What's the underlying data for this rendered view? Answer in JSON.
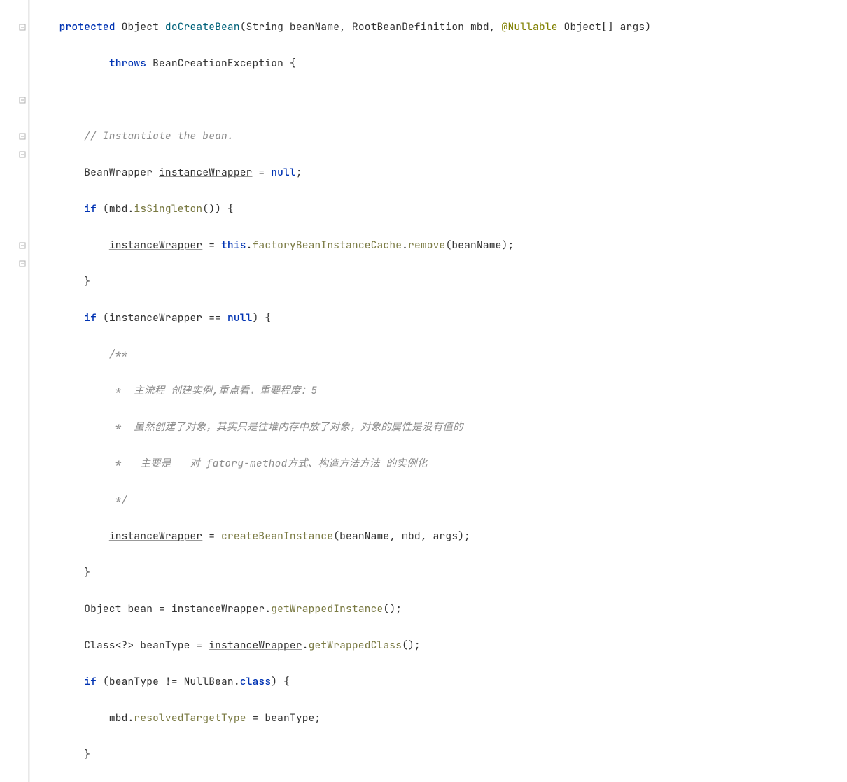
{
  "gutter": {
    "markers": [
      false,
      true,
      false,
      false,
      false,
      true,
      false,
      true,
      true,
      false,
      false,
      false,
      false,
      true,
      true,
      false,
      false,
      false,
      false,
      false,
      false
    ]
  },
  "code": {
    "l0": {
      "kw1": "protected",
      "t1": " Object ",
      "m": "doCreateBean",
      "t2": "(String beanName, RootBeanDefinition mbd, ",
      "anno": "@Nullable",
      "t3": " Object[] args)"
    },
    "l1": {
      "kw1": "throws",
      "t1": " BeanCreationException {"
    },
    "l2": {
      "t": ""
    },
    "l3": {
      "c": "// Instantiate the bean."
    },
    "l4": {
      "t1": "BeanWrapper ",
      "u": "instanceWrapper",
      "t2": " = ",
      "kw": "null",
      "t3": ";"
    },
    "l5": {
      "kw": "if",
      "t1": " (mbd.",
      "m": "isSingleton",
      "t2": "()) {"
    },
    "l6": {
      "u": "instanceWrapper",
      "t1": " = ",
      "kw": "this",
      "t2": ".",
      "f": "factoryBeanInstanceCache",
      "t3": ".",
      "m": "remove",
      "t4": "(beanName);"
    },
    "l7": {
      "t": "}"
    },
    "l8": {
      "kw": "if",
      "t1": " (",
      "u": "instanceWrapper",
      "t2": " == ",
      "kw2": "null",
      "t3": ") {"
    },
    "l9": {
      "c": "/**"
    },
    "l10": {
      "c": " *  主流程 创建实例,重点看，重要程度：5"
    },
    "l11": {
      "c": " *  虽然创建了对象，其实只是往堆内存中放了对象，对象的属性是没有值的"
    },
    "l12": {
      "c": " *   主要是   对 fatory-method方式、构造方法方法 的实例化"
    },
    "l13": {
      "c": " */"
    },
    "l14": {
      "u": "instanceWrapper",
      "t1": " = ",
      "m": "createBeanInstance",
      "t2": "(beanName, mbd, args);"
    },
    "l15": {
      "t": "}"
    },
    "l16": {
      "t1": "Object bean = ",
      "u": "instanceWrapper",
      "t2": ".",
      "m": "getWrappedInstance",
      "t3": "();"
    },
    "l17": {
      "t1": "Class<?> beanType = ",
      "u": "instanceWrapper",
      "t2": ".",
      "m": "getWrappedClass",
      "t3": "();"
    },
    "l18": {
      "kw": "if",
      "t1": " (beanType != NullBean.",
      "kw2": "class",
      "t2": ") {"
    },
    "l19": {
      "t1": "mbd.",
      "f": "resolvedTargetType",
      "t2": " = beanType;"
    },
    "l20": {
      "t": "}"
    }
  }
}
